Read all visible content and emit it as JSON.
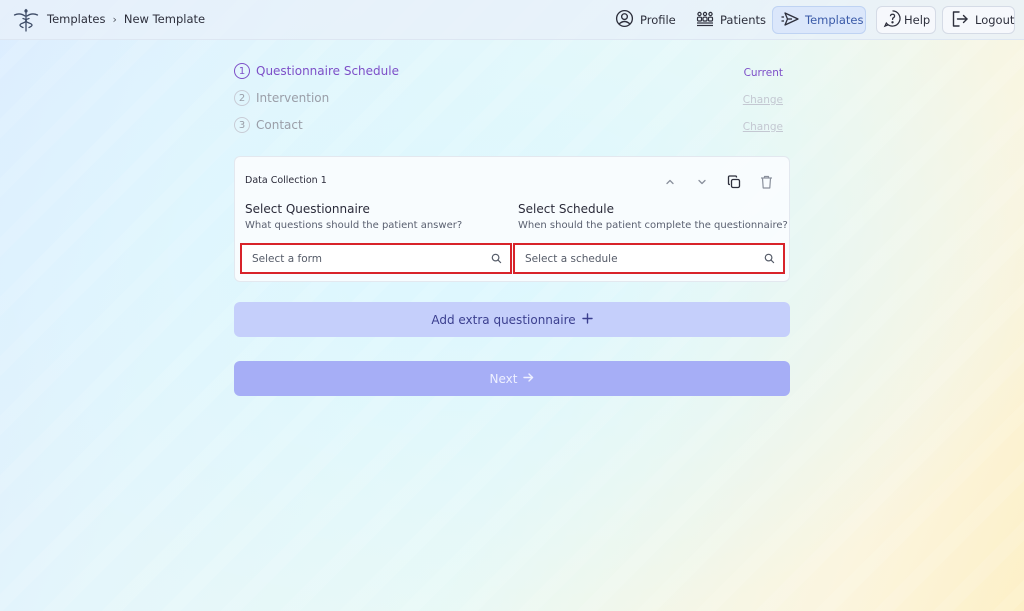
{
  "breadcrumb": {
    "root": "Templates",
    "separator": "›",
    "current": "New Template"
  },
  "nav": {
    "profile": "Profile",
    "patients": "Patients",
    "templates": "Templates",
    "help": "Help",
    "logout": "Logout"
  },
  "steps": [
    {
      "number": "1",
      "label": "Questionnaire Schedule",
      "status": "Current"
    },
    {
      "number": "2",
      "label": "Intervention",
      "status": "Change"
    },
    {
      "number": "3",
      "label": "Contact",
      "status": "Change"
    }
  ],
  "card": {
    "title": "Data Collection 1",
    "questionnaire": {
      "heading": "Select Questionnaire",
      "subheading": "What questions should the patient answer?",
      "placeholder": "Select a form"
    },
    "schedule": {
      "heading": "Select Schedule",
      "subheading": "When should the patient complete the questionnaire?",
      "placeholder": "Select a schedule"
    }
  },
  "buttons": {
    "add_extra": "Add extra questionnaire",
    "next": "Next"
  },
  "icons": {
    "logo": "caduceus-logo-icon",
    "profile": "user-circle-icon",
    "patients": "people-group-icon",
    "templates": "send-icon",
    "help": "question-bubble-icon",
    "logout": "logout-icon",
    "move_up": "chevron-up-icon",
    "move_down": "chevron-down-icon",
    "copy": "copy-icon",
    "delete": "trash-icon",
    "search": "search-icon",
    "add": "plus-icon",
    "next": "arrow-right-icon"
  },
  "colors": {
    "accent_purple": "#7d4fc8",
    "highlight_red": "#d8232a",
    "add_button": "#c5cffb",
    "next_button": "#a6aef6",
    "active_nav": "#dbe7fb"
  }
}
